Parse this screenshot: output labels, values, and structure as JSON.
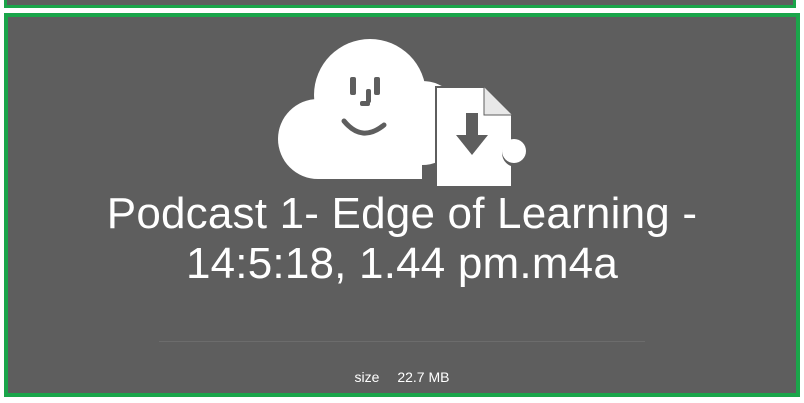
{
  "file": {
    "title_line1": "Podcast 1- Edge of Learning -",
    "title_line2": "14:5:18, 1.44 pm.m4a"
  },
  "details": {
    "size_label": "size",
    "size_value": "22.7 MB"
  },
  "icons": {
    "preview": "cloud-face-download-icon"
  },
  "colors": {
    "background": "#5e5e5e",
    "border": "#1aa54a",
    "text": "#ffffff"
  }
}
